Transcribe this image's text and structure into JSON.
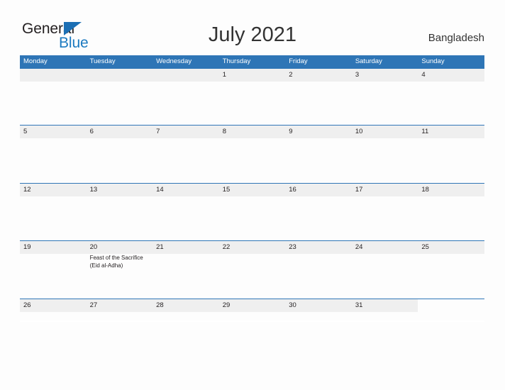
{
  "brand": {
    "name_top": "General",
    "name_bottom": "Blue",
    "triangle_icon": "flag-triangle-icon",
    "color_blue": "#1c7ac0",
    "color_dark": "#231f20"
  },
  "header": {
    "title": "July 2021",
    "region": "Bangladesh"
  },
  "calendar": {
    "header_color": "#2e75b6",
    "band_color": "#efefef",
    "weekdays": [
      "Monday",
      "Tuesday",
      "Wednesday",
      "Thursday",
      "Friday",
      "Saturday",
      "Sunday"
    ],
    "weeks": [
      [
        {
          "day": "",
          "event": ""
        },
        {
          "day": "",
          "event": ""
        },
        {
          "day": "",
          "event": ""
        },
        {
          "day": "1",
          "event": ""
        },
        {
          "day": "2",
          "event": ""
        },
        {
          "day": "3",
          "event": ""
        },
        {
          "day": "4",
          "event": ""
        }
      ],
      [
        {
          "day": "5",
          "event": ""
        },
        {
          "day": "6",
          "event": ""
        },
        {
          "day": "7",
          "event": ""
        },
        {
          "day": "8",
          "event": ""
        },
        {
          "day": "9",
          "event": ""
        },
        {
          "day": "10",
          "event": ""
        },
        {
          "day": "11",
          "event": ""
        }
      ],
      [
        {
          "day": "12",
          "event": ""
        },
        {
          "day": "13",
          "event": ""
        },
        {
          "day": "14",
          "event": ""
        },
        {
          "day": "15",
          "event": ""
        },
        {
          "day": "16",
          "event": ""
        },
        {
          "day": "17",
          "event": ""
        },
        {
          "day": "18",
          "event": ""
        }
      ],
      [
        {
          "day": "19",
          "event": ""
        },
        {
          "day": "20",
          "event": "Feast of the Sacrifice (Eid al-Adha)"
        },
        {
          "day": "21",
          "event": ""
        },
        {
          "day": "22",
          "event": ""
        },
        {
          "day": "23",
          "event": ""
        },
        {
          "day": "24",
          "event": ""
        },
        {
          "day": "25",
          "event": ""
        }
      ],
      [
        {
          "day": "26",
          "event": ""
        },
        {
          "day": "27",
          "event": ""
        },
        {
          "day": "28",
          "event": ""
        },
        {
          "day": "29",
          "event": ""
        },
        {
          "day": "30",
          "event": ""
        },
        {
          "day": "31",
          "event": ""
        },
        {
          "day": "",
          "event": ""
        }
      ]
    ]
  }
}
